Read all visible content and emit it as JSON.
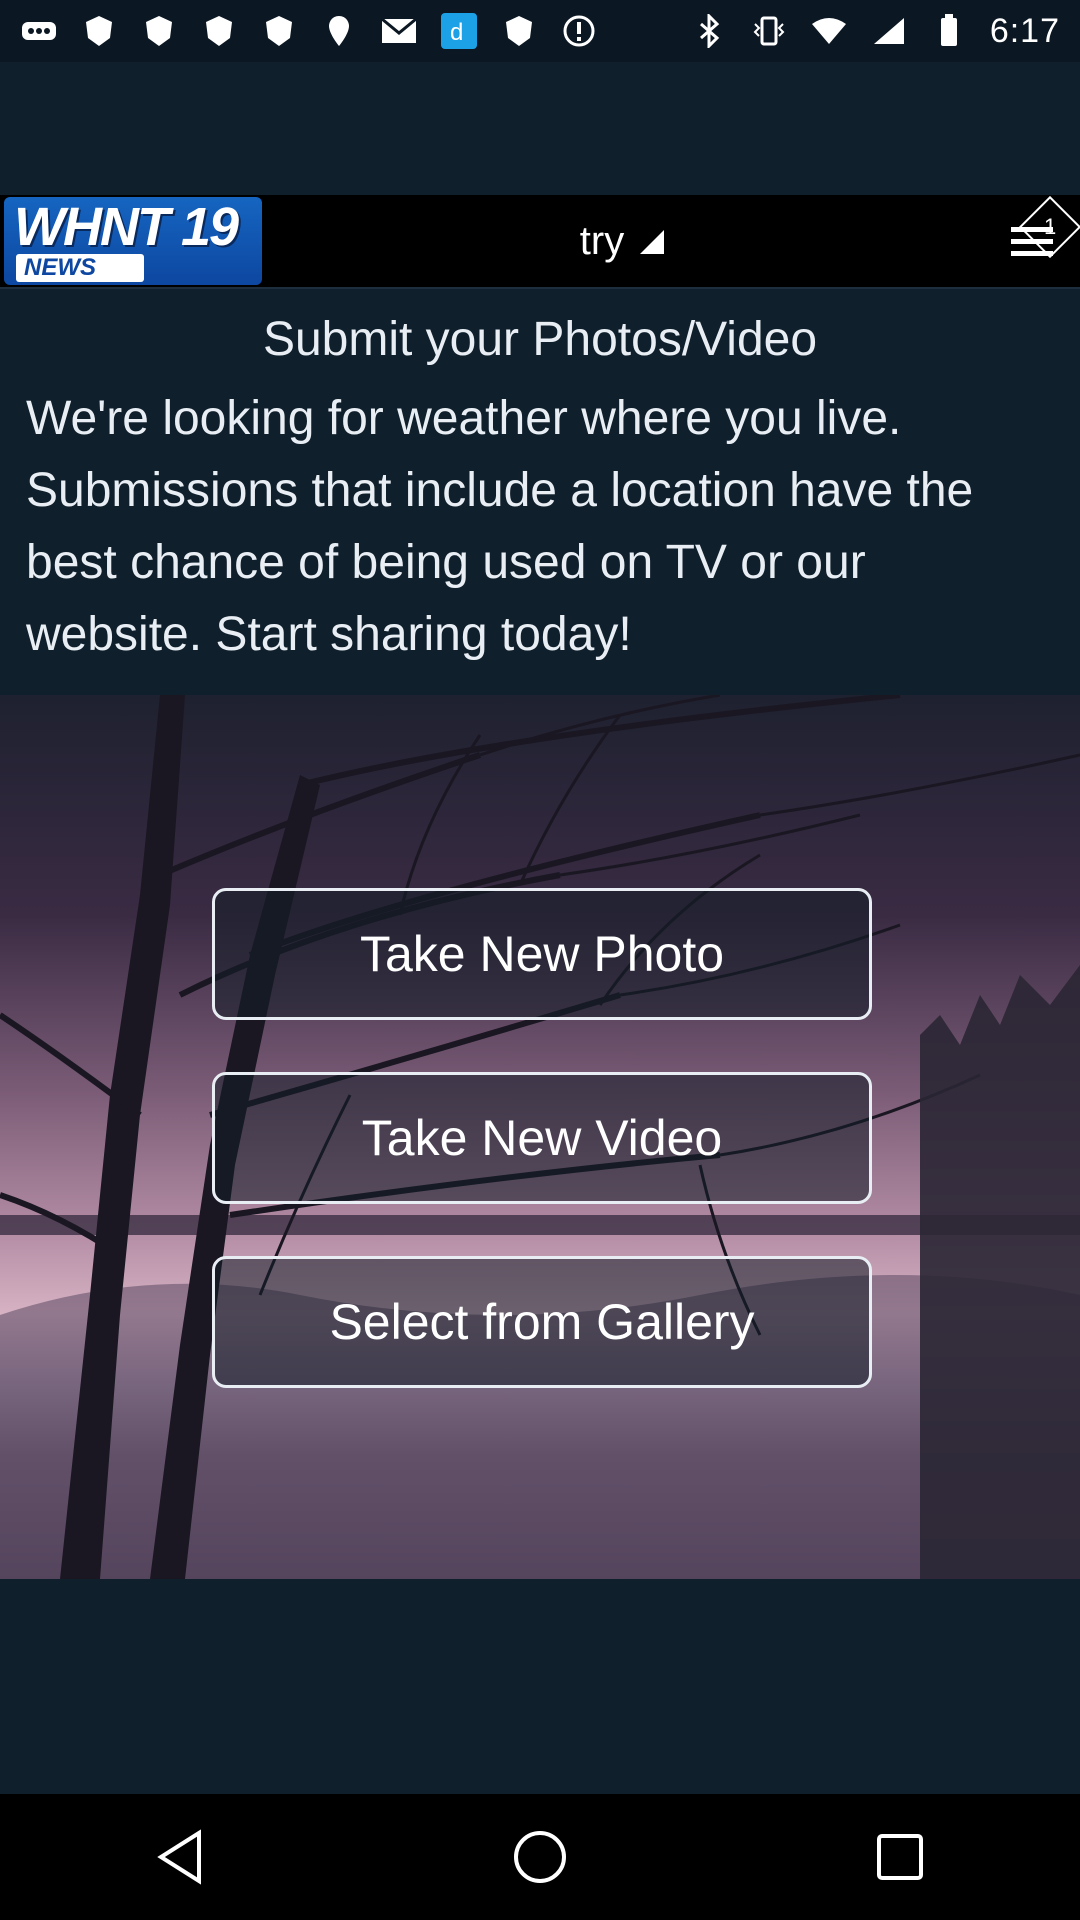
{
  "status_bar": {
    "time": "6:17",
    "left_icons": [
      "more-icon",
      "nfl-icon",
      "nfl-icon",
      "nfl-icon",
      "nfl-icon",
      "nfl-icon",
      "mail-icon",
      "app-icon",
      "nfl-icon",
      "info-icon"
    ],
    "right_icons": [
      "bluetooth-icon",
      "vibrate-icon",
      "wifi-icon",
      "signal-icon",
      "battery-icon"
    ]
  },
  "header": {
    "logo_text_top": "WHNT 19",
    "logo_text_bottom": "NEWS",
    "dropdown_label": "try",
    "menu_badge": "1"
  },
  "intro": {
    "title": "Submit your Photos/Video",
    "text": "We're looking for weather where you live. Submissions that include a location have the best chance of being used on TV or our website. Start sharing today!"
  },
  "actions": {
    "take_photo": "Take New Photo",
    "take_video": "Take New Video",
    "select_gallery": "Select from Gallery"
  },
  "colors": {
    "background": "#0f1f2c",
    "header": "#000000",
    "accent_logo": "#1565c0"
  }
}
